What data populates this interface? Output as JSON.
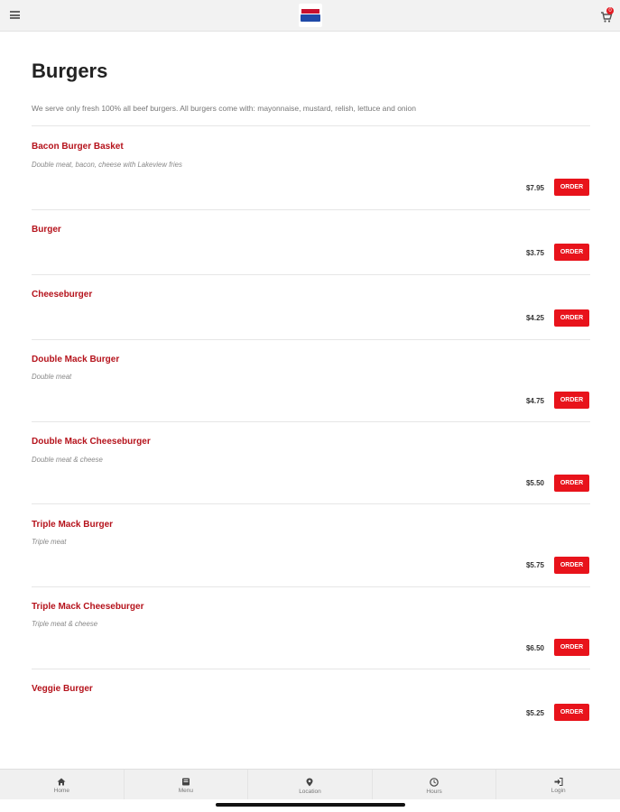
{
  "header": {
    "cart_count": "0"
  },
  "page": {
    "title": "Burgers",
    "intro": "We serve only fresh 100% all beef burgers. All burgers come with: mayonnaise, mustard, relish, lettuce and onion"
  },
  "items": [
    {
      "name": "Bacon Burger Basket",
      "desc": "Double meat, bacon, cheese with Lakeview fries",
      "price": "$7.95",
      "button": "ORDER"
    },
    {
      "name": "Burger",
      "desc": "",
      "price": "$3.75",
      "button": "ORDER"
    },
    {
      "name": "Cheeseburger",
      "desc": "",
      "price": "$4.25",
      "button": "ORDER"
    },
    {
      "name": "Double Mack Burger",
      "desc": "Double meat",
      "price": "$4.75",
      "button": "ORDER"
    },
    {
      "name": "Double Mack Cheeseburger",
      "desc": "Double meat & cheese",
      "price": "$5.50",
      "button": "ORDER"
    },
    {
      "name": "Triple Mack Burger",
      "desc": "Triple meat",
      "price": "$5.75",
      "button": "ORDER"
    },
    {
      "name": "Triple Mack Cheeseburger",
      "desc": "Triple meat & cheese",
      "price": "$6.50",
      "button": "ORDER"
    },
    {
      "name": "Veggie Burger",
      "desc": "",
      "price": "$5.25",
      "button": "ORDER"
    }
  ],
  "tabs": [
    {
      "label": "Home",
      "icon": "home-icon"
    },
    {
      "label": "Menu",
      "icon": "menu-book-icon"
    },
    {
      "label": "Location",
      "icon": "map-pin-icon"
    },
    {
      "label": "Hours",
      "icon": "clock-icon"
    },
    {
      "label": "Login",
      "icon": "login-icon"
    }
  ]
}
